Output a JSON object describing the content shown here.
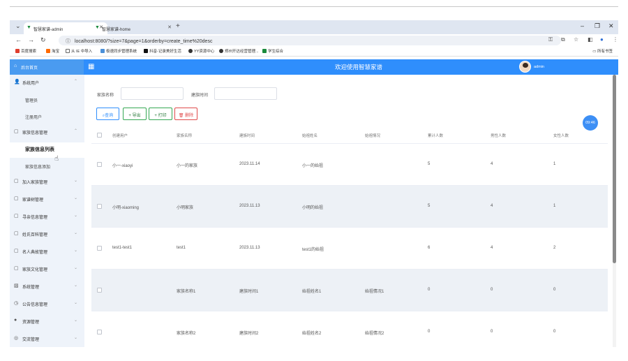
{
  "browser": {
    "tabs": [
      {
        "label": "智慧家谱-admin",
        "active": true
      },
      {
        "label": "智慧家谱-home",
        "active": false
      }
    ],
    "url": "localhost:8080/?size=7&page=1&orderby=create_time%20desc",
    "bookmarks": [
      {
        "label": "百度搜索",
        "color": "#e03e2d"
      },
      {
        "label": "淘宝",
        "color": "#ff6a00"
      },
      {
        "label": "从 IE 中导入",
        "color": "#666666"
      },
      {
        "label": "极速同步管理系统",
        "color": "#4a90d9"
      },
      {
        "label": "抖音-记录美好生活",
        "color": "#111111"
      },
      {
        "label": "YY资源中心",
        "color": "#333333"
      },
      {
        "label": "郑州开达经营管理...",
        "color": "#333333"
      },
      {
        "label": "学生综合",
        "color": "#1a8a3c"
      }
    ],
    "all_bookmarks": "所有书签"
  },
  "header": {
    "brand": "后台首页",
    "title": "欢迎使用智慧家谱",
    "user": "admin"
  },
  "sidebar": {
    "items": [
      {
        "label": "系统用户",
        "icon": "user-icon",
        "open": true,
        "children": [
          "管理员",
          "注册用户"
        ]
      },
      {
        "label": "家族信息管理",
        "icon": "doc-icon",
        "open": true,
        "children": [
          "家族信息列表",
          "家族信息添加"
        ]
      },
      {
        "label": "加入家族管理",
        "icon": "doc-icon"
      },
      {
        "label": "家谱树管理",
        "icon": "doc-icon"
      },
      {
        "label": "寻亲信息管理",
        "icon": "doc-icon"
      },
      {
        "label": "姓氏百科管理",
        "icon": "doc-icon"
      },
      {
        "label": "名人典故管理",
        "icon": "doc-icon"
      },
      {
        "label": "家族文化管理",
        "icon": "doc-icon"
      },
      {
        "label": "系统管理",
        "icon": "image-icon"
      },
      {
        "label": "公告信息管理",
        "icon": "clock-icon"
      },
      {
        "label": "资源管理",
        "icon": "pin-icon"
      },
      {
        "label": "交流管理",
        "icon": "chat-icon"
      }
    ]
  },
  "filters": {
    "family_name_label": "家族名称",
    "create_time_label": "建族时间"
  },
  "toolbar": {
    "search": "查询",
    "export": "导出",
    "print": "打印",
    "delete": "删除"
  },
  "table": {
    "columns": [
      "创建用户",
      "家族名称",
      "建族时间",
      "始祖姓名",
      "始祖情况",
      "累计人数",
      "男性人数",
      "女性人数"
    ],
    "rows": [
      [
        "小一-xiaoyi",
        "小一的家族",
        "2023.11.14",
        "小一的始祖",
        "",
        "5",
        "4",
        "1"
      ],
      [
        "小明-xiaoming",
        "小明家族",
        "2023.11.13",
        "小明的始祖",
        "",
        "5",
        "4",
        "1"
      ],
      [
        "test1-test1",
        "test1",
        "2023.11.13",
        "test1的始祖",
        "",
        "6",
        "4",
        "2"
      ],
      [
        "",
        "家族名称1",
        "建族时间1",
        "始祖姓名1",
        "始祖情况1",
        "0",
        "0",
        "0"
      ],
      [
        "",
        "家族名称2",
        "建族时间2",
        "始祖姓名2",
        "始祖情况2",
        "0",
        "0",
        "0"
      ]
    ]
  },
  "float_clock": "09:46"
}
